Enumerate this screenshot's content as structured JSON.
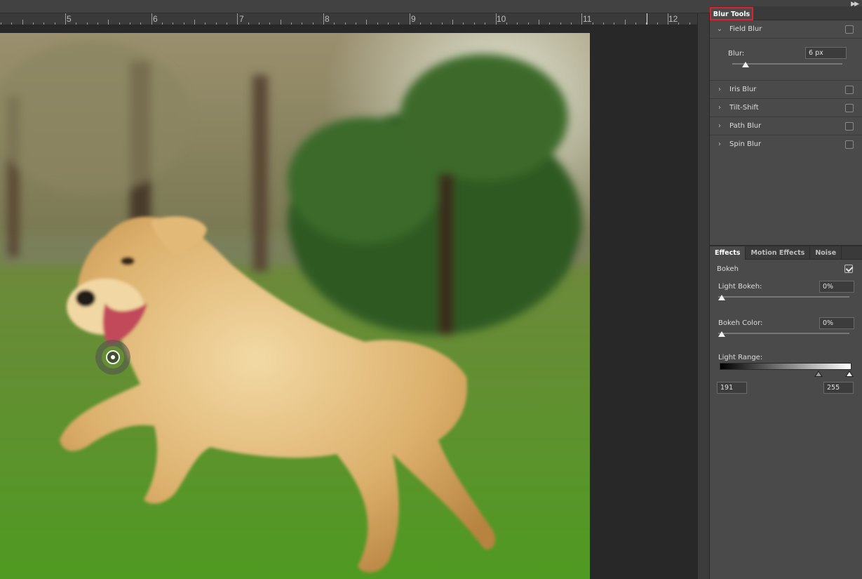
{
  "ruler": {
    "labels": [
      "5",
      "6",
      "7",
      "8",
      "9",
      "10",
      "11",
      "12"
    ]
  },
  "panel": {
    "tab_title": "Blur Tools",
    "tools": [
      {
        "label": "Field Blur",
        "expanded": true,
        "checked": false
      },
      {
        "label": "Iris Blur",
        "expanded": false,
        "checked": false
      },
      {
        "label": "Tilt-Shift",
        "expanded": false,
        "checked": false
      },
      {
        "label": "Path Blur",
        "expanded": false,
        "checked": false
      },
      {
        "label": "Spin Blur",
        "expanded": false,
        "checked": false
      }
    ],
    "field_blur": {
      "blur_label": "Blur:",
      "blur_value": "6 px",
      "blur_slider_fraction": 0.12
    }
  },
  "effects": {
    "tabs": [
      "Effects",
      "Motion Effects",
      "Noise"
    ],
    "active_tab": "Effects",
    "bokeh_label": "Bokeh",
    "bokeh_checked": true,
    "light_bokeh_label": "Light Bokeh:",
    "light_bokeh_value": "0%",
    "light_bokeh_fraction": 0,
    "bokeh_color_label": "Bokeh Color:",
    "bokeh_color_value": "0%",
    "bokeh_color_fraction": 0,
    "light_range_label": "Light Range:",
    "light_range_low": "191",
    "light_range_high": "255",
    "light_range_low_fraction": 0.749,
    "light_range_high_fraction": 1.0
  },
  "icons": {
    "collapse": "double-chevron-right-icon",
    "expand_down": "chevron-down-icon",
    "expand_right": "chevron-right-icon",
    "blur_pin": "blur-pin-icon"
  },
  "colors": {
    "panel_bg": "#4a4a4a",
    "highlight_border": "#e0202c",
    "canvas_bg": "#282828"
  }
}
